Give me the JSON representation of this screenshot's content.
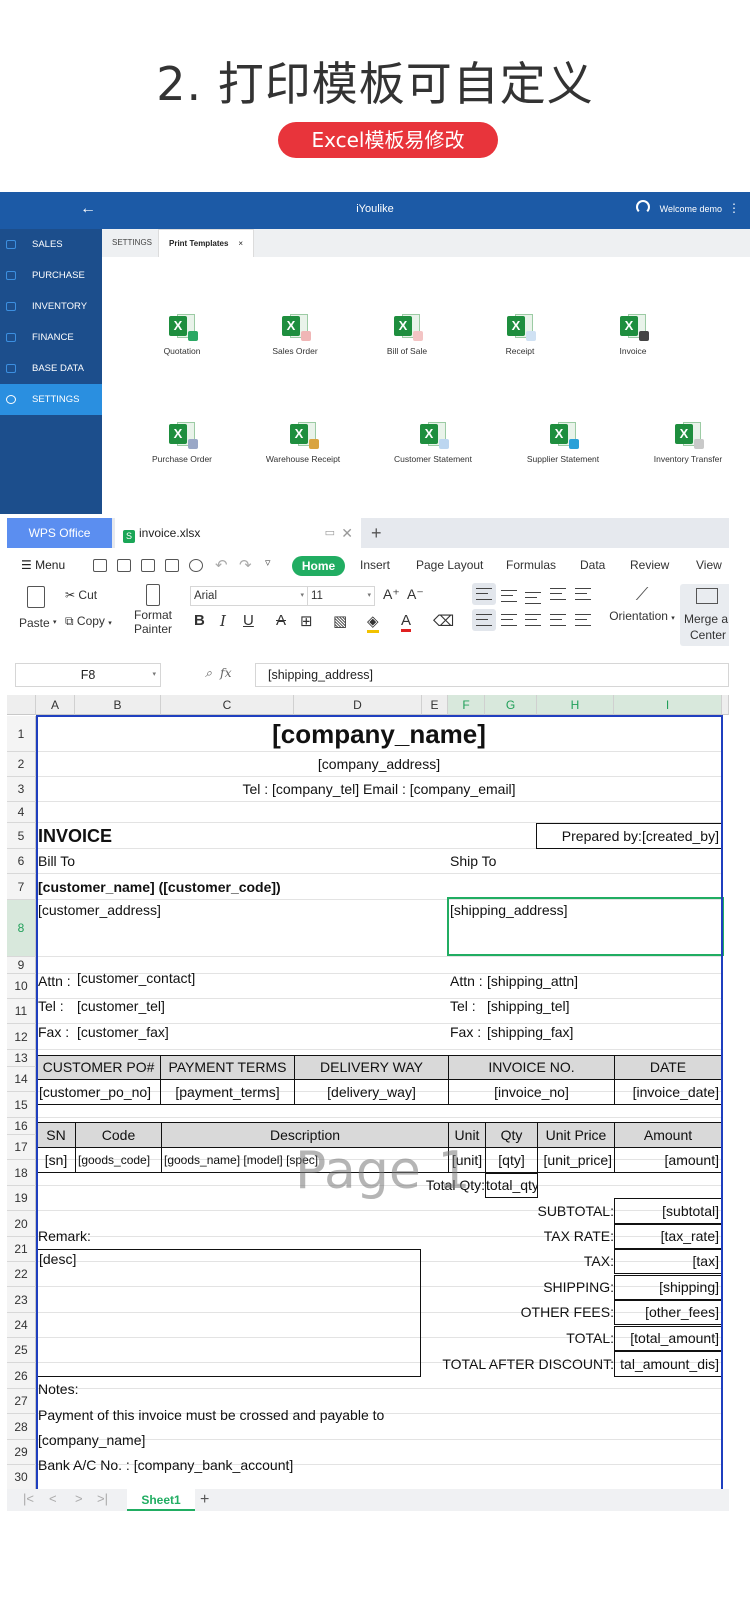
{
  "hero": {
    "title": "2. 打印模板可自定义",
    "pill": "Excel模板易修改"
  },
  "app": {
    "title": "iYoulike",
    "back_icon": "←",
    "welcome": "Welcome demo",
    "more_icon": "⋮",
    "sidebar": {
      "items": [
        {
          "label": "SALES",
          "icon": "gauge-icon"
        },
        {
          "label": "PURCHASE",
          "icon": "bag-icon"
        },
        {
          "label": "INVENTORY",
          "icon": "box-icon"
        },
        {
          "label": "FINANCE",
          "icon": "wallet-icon"
        },
        {
          "label": "BASE DATA",
          "icon": "file-icon"
        },
        {
          "label": "SETTINGS",
          "icon": "gear-icon",
          "active": true
        }
      ]
    },
    "tabs": [
      {
        "label": "SETTINGS"
      },
      {
        "label": "Print Templates",
        "close": "×"
      }
    ],
    "templates": [
      "Quotation",
      "Sales Order",
      "Bill of Sale",
      "Receipt",
      "Invoice",
      "Purchase Order",
      "Warehouse Receipt",
      "Customer Statement",
      "Supplier Statement",
      "Inventory Transfer"
    ]
  },
  "wps": {
    "brand": "WPS Office",
    "file_name": "invoice.xlsx",
    "new_tab": "+",
    "menu": "Menu",
    "home": "Home",
    "tabs": [
      "Insert",
      "Page Layout",
      "Formulas",
      "Data",
      "Review",
      "View"
    ],
    "ribbon": {
      "paste": "Paste",
      "cut": "Cut",
      "copy": "Copy",
      "format_painter_1": "Format",
      "format_painter_2": "Painter",
      "font": "Arial",
      "size": "11",
      "orientation": "Orientation",
      "merge_1": "Merge a",
      "merge_2": "Center"
    },
    "namebox": "F8",
    "fx": "fx",
    "formula": "[shipping_address]",
    "sheet_tab": "Sheet1",
    "sheet_add": "+",
    "watermark": "Page 1",
    "columns": [
      "A",
      "B",
      "C",
      "D",
      "E",
      "F",
      "G",
      "H",
      "I"
    ],
    "rows": [
      "1",
      "2",
      "3",
      "4",
      "5",
      "6",
      "7",
      "8",
      "9",
      "10",
      "11",
      "12",
      "13",
      "14",
      "15",
      "16",
      "17",
      "18",
      "19",
      "20",
      "21",
      "22",
      "23",
      "24",
      "25",
      "26",
      "27",
      "28",
      "29",
      "30"
    ],
    "cells": {
      "company_name": "[company_name]",
      "company_address": "[company_address]",
      "tel_line": "Tel : [company_tel]     Email : [company_email]",
      "invoice": "INVOICE",
      "prepared_by": "Prepared by:[created_by]",
      "bill_to": "Bill To",
      "ship_to": "Ship To",
      "customer_name": "[customer_name] ([customer_code])",
      "customer_address": "[customer_address]",
      "shipping_address": "[shipping_address]",
      "attn_label": "Attn :",
      "customer_contact": "[customer_contact]",
      "shipping_attn": "[shipping_attn]",
      "tel_label": "Tel  :",
      "customer_tel": "[customer_tel]",
      "shipping_tel": "[shipping_tel]",
      "fax_label": "Fax :",
      "customer_fax": "[customer_fax]",
      "shipping_fax": "[shipping_fax]",
      "h_customer_po": "CUSTOMER PO#",
      "h_payment_terms": "PAYMENT TERMS",
      "h_delivery_way": "DELIVERY WAY",
      "h_invoice_no": "INVOICE NO.",
      "h_date": "DATE",
      "customer_po_no": "[customer_po_no]",
      "payment_terms": "[payment_terms]",
      "delivery_way": "[delivery_way]",
      "invoice_no": "[invoice_no]",
      "invoice_date": "[invoice_date]",
      "h_sn": "SN",
      "h_code": "Code",
      "h_description": "Description",
      "h_unit": "Unit",
      "h_qty": "Qty",
      "h_unit_price": "Unit Price",
      "h_amount": "Amount",
      "sn": "[sn]",
      "goods_code": "[goods_code]",
      "goods_desc": "[goods_name] [model] [spec]",
      "unit": "[unit]",
      "qty": "[qty]",
      "unit_price": "[unit_price]",
      "amount": "[amount]",
      "total_qty_label": "Total Qty:",
      "total_qty": "total_qty",
      "subtotal_label": "SUBTOTAL:",
      "subtotal": "[subtotal]",
      "remark": "Remark:",
      "tax_rate_label": "TAX RATE:",
      "tax_rate": "[tax_rate]",
      "desc": "[desc]",
      "tax_label": "TAX:",
      "tax": "[tax]",
      "shipping_label": "SHIPPING:",
      "shipping": "[shipping]",
      "other_fees_label": "OTHER FEES:",
      "other_fees": "[other_fees]",
      "total_label": "TOTAL:",
      "total_amount": "[total_amount]",
      "total_after_label": "TOTAL AFTER DISCOUNT:",
      "total_after": "tal_amount_dis]",
      "notes": "Notes:",
      "payment_note": "Payment of this invoice must be crossed and payable to",
      "company_name_2": "[company_name]",
      "bank_line": "Bank A/C No. : [company_bank_account]"
    }
  },
  "colors": {
    "accent": "#21ad62",
    "header": "#1c5aa6",
    "sidebar": "#1c4e8c",
    "sidebar_active": "#2a8fe0",
    "pill": "#e8343b"
  }
}
